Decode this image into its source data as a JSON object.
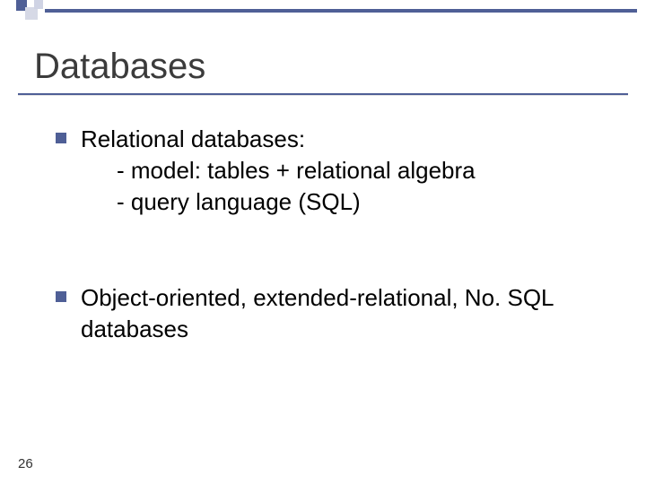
{
  "slide": {
    "title": "Databases",
    "page_number": "26",
    "items": [
      {
        "heading": "Relational databases:",
        "subs": [
          "- model: tables + relational algebra",
          "- query language (SQL)"
        ]
      },
      {
        "heading": "Object-oriented, extended-relational, No. SQL databases",
        "subs": []
      }
    ]
  }
}
